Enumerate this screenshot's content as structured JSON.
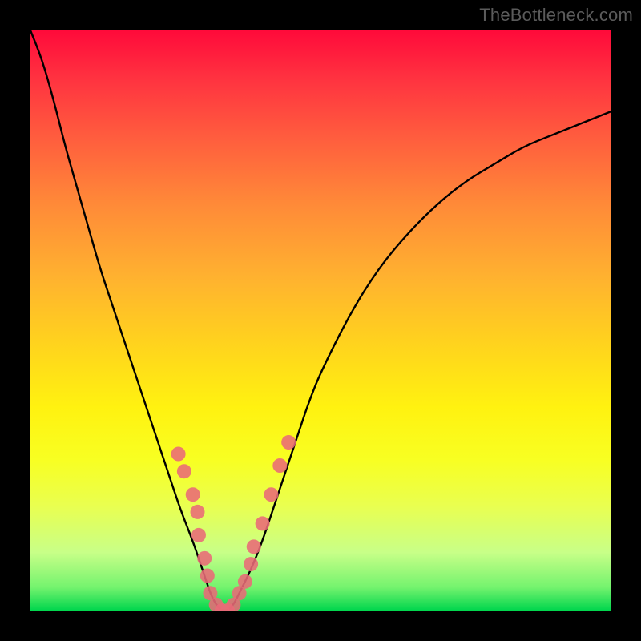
{
  "watermark": "TheBottleneck.com",
  "chart_data": {
    "type": "line",
    "title": "",
    "xlabel": "",
    "ylabel": "",
    "xlim": [
      0,
      100
    ],
    "ylim": [
      0,
      100
    ],
    "grid": false,
    "legend": false,
    "background_gradient_top": "#ff0a3a",
    "background_gradient_bottom": "#00d64d",
    "series": [
      {
        "name": "curve",
        "color": "#000000",
        "x": [
          0,
          2,
          4,
          6,
          8,
          10,
          12,
          14,
          16,
          18,
          20,
          22,
          24,
          26,
          28,
          30,
          31,
          32,
          33,
          34,
          35,
          36,
          38,
          40,
          42,
          44,
          46,
          48,
          50,
          55,
          60,
          65,
          70,
          75,
          80,
          85,
          90,
          95,
          100
        ],
        "y": [
          100,
          95,
          88,
          80,
          73,
          66,
          59,
          53,
          47,
          41,
          35,
          29,
          23,
          17,
          12,
          6,
          3,
          1,
          0,
          0,
          1,
          3,
          7,
          12,
          18,
          24,
          30,
          36,
          41,
          51,
          59,
          65,
          70,
          74,
          77,
          80,
          82,
          84,
          86
        ]
      }
    ],
    "markers": {
      "name": "dots",
      "color": "#e96a78",
      "radius_px": 9,
      "points": [
        {
          "x": 25.5,
          "y": 27
        },
        {
          "x": 26.5,
          "y": 24
        },
        {
          "x": 28.0,
          "y": 20
        },
        {
          "x": 28.8,
          "y": 17
        },
        {
          "x": 29.0,
          "y": 13
        },
        {
          "x": 30.0,
          "y": 9
        },
        {
          "x": 30.5,
          "y": 6
        },
        {
          "x": 31.0,
          "y": 3
        },
        {
          "x": 32.0,
          "y": 1
        },
        {
          "x": 33.0,
          "y": 0
        },
        {
          "x": 34.0,
          "y": 0
        },
        {
          "x": 35.0,
          "y": 1
        },
        {
          "x": 36.0,
          "y": 3
        },
        {
          "x": 37.0,
          "y": 5
        },
        {
          "x": 38.0,
          "y": 8
        },
        {
          "x": 38.5,
          "y": 11
        },
        {
          "x": 40.0,
          "y": 15
        },
        {
          "x": 41.5,
          "y": 20
        },
        {
          "x": 43.0,
          "y": 25
        },
        {
          "x": 44.5,
          "y": 29
        }
      ]
    }
  }
}
